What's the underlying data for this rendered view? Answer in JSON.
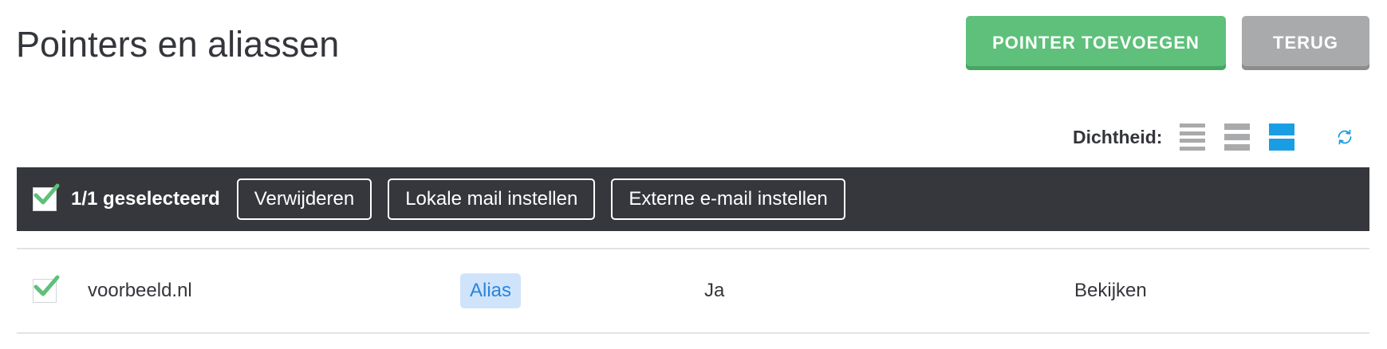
{
  "header": {
    "title": "Pointers en aliassen",
    "add_button": "POINTER TOEVOEGEN",
    "back_button": "TERUG"
  },
  "density": {
    "label": "Dichtheid:",
    "options": [
      "compact",
      "normal",
      "spacious"
    ],
    "selected": "spacious",
    "refresh_icon": "refresh-icon"
  },
  "toolbar": {
    "selected_count": "1/1 geselecteerd",
    "delete_button": "Verwijderen",
    "local_mail_button": "Lokale mail instellen",
    "external_mail_button": "Externe e-mail instellen"
  },
  "rows": [
    {
      "checked": true,
      "domain": "voorbeeld.nl",
      "type": "Alias",
      "active": "Ja",
      "action": "Bekijken"
    }
  ],
  "colors": {
    "primary_green": "#5ec07a",
    "secondary_gray": "#a9aaab",
    "toolbar_bg": "#35373c",
    "accent_blue": "#1a9ee3",
    "badge_bg": "#cfe4fb",
    "badge_text": "#2a84dc"
  }
}
